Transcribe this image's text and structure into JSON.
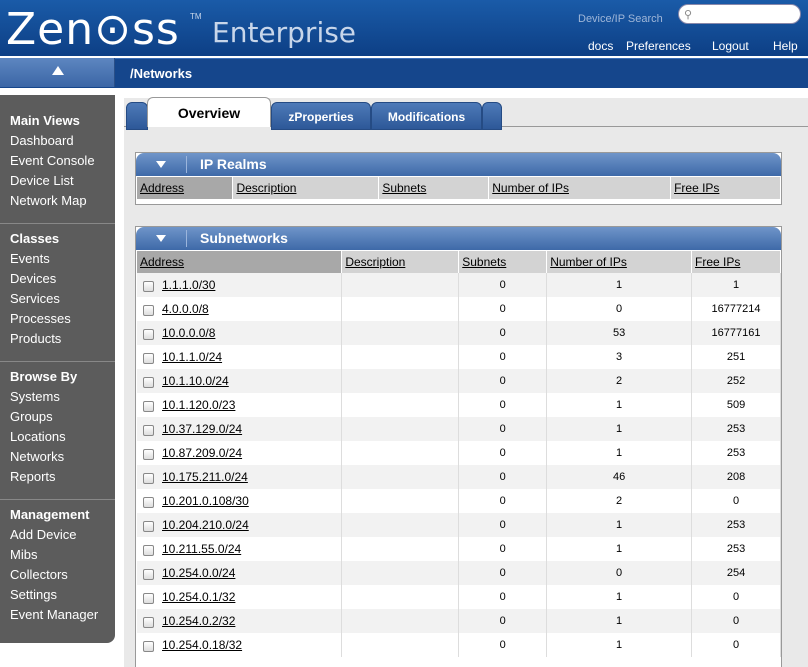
{
  "header": {
    "logo": "Zen⊙ss",
    "logo_tm": "TM",
    "logo_sub": "Enterprise",
    "search_label": "Device/IP Search",
    "search_placeholder": "",
    "links": [
      "docs",
      "Preferences",
      "Logout",
      "Help"
    ]
  },
  "path": "/Networks",
  "sidebar": {
    "groups": [
      {
        "title": "Main Views",
        "items": [
          "Dashboard",
          "Event Console",
          "Device List",
          "Network Map"
        ]
      },
      {
        "title": "Classes",
        "items": [
          "Events",
          "Devices",
          "Services",
          "Processes",
          "Products"
        ]
      },
      {
        "title": "Browse By",
        "items": [
          "Systems",
          "Groups",
          "Locations",
          "Networks",
          "Reports"
        ]
      },
      {
        "title": "Management",
        "items": [
          "Add Device",
          "Mibs",
          "Collectors",
          "Settings",
          "Event Manager"
        ]
      }
    ]
  },
  "tabs": [
    "Overview",
    "zProperties",
    "Modifications"
  ],
  "ip_realms": {
    "title": "IP Realms",
    "columns": [
      "Address",
      "Description",
      "Subnets",
      "Number of IPs",
      "Free IPs"
    ]
  },
  "subnetworks": {
    "title": "Subnetworks",
    "columns": [
      "Address",
      "Description",
      "Subnets",
      "Number of IPs",
      "Free IPs"
    ],
    "rows": [
      [
        "1.1.1.0/30",
        "",
        "0",
        "1",
        "1"
      ],
      [
        "4.0.0.0/8",
        "",
        "0",
        "0",
        "16777214"
      ],
      [
        "10.0.0.0/8",
        "",
        "0",
        "53",
        "16777161"
      ],
      [
        "10.1.1.0/24",
        "",
        "0",
        "3",
        "251"
      ],
      [
        "10.1.10.0/24",
        "",
        "0",
        "2",
        "252"
      ],
      [
        "10.1.120.0/23",
        "",
        "0",
        "1",
        "509"
      ],
      [
        "10.37.129.0/24",
        "",
        "0",
        "1",
        "253"
      ],
      [
        "10.87.209.0/24",
        "",
        "0",
        "1",
        "253"
      ],
      [
        "10.175.211.0/24",
        "",
        "0",
        "46",
        "208"
      ],
      [
        "10.201.0.108/30",
        "",
        "0",
        "2",
        "0"
      ],
      [
        "10.204.210.0/24",
        "",
        "0",
        "1",
        "253"
      ],
      [
        "10.211.55.0/24",
        "",
        "0",
        "1",
        "253"
      ],
      [
        "10.254.0.0/24",
        "",
        "0",
        "0",
        "254"
      ],
      [
        "10.254.0.1/32",
        "",
        "0",
        "1",
        "0"
      ],
      [
        "10.254.0.2/32",
        "",
        "0",
        "1",
        "0"
      ],
      [
        "10.254.0.18/32",
        "",
        "0",
        "1",
        "0"
      ]
    ]
  },
  "colors": {
    "header": "#1a5ba8",
    "pathbar": "#15468c",
    "sidebar": "#5c5c5c"
  }
}
